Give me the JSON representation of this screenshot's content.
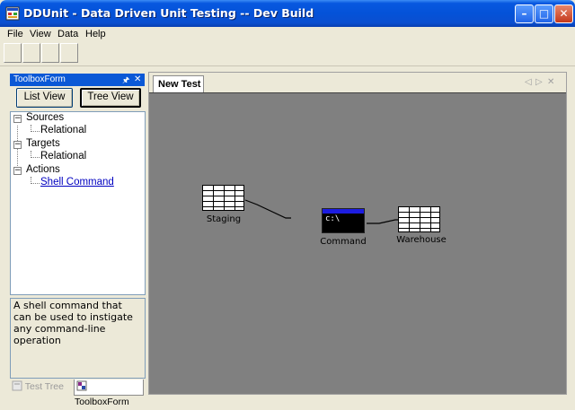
{
  "window": {
    "title": "DDUnit - Data Driven Unit Testing -- Dev Build",
    "controls": {
      "minimize": "–",
      "maximize": "□",
      "close": "✕"
    }
  },
  "menu": [
    {
      "label": "File"
    },
    {
      "label": "View"
    },
    {
      "label": "Data"
    },
    {
      "label": "Help"
    }
  ],
  "toolbox": {
    "title": "ToolboxForm",
    "pin_icon": "pin-icon",
    "close_icon": "close-icon",
    "list_view_label": "List View",
    "tree_view_label": "Tree View",
    "tree": [
      {
        "label": "Sources",
        "expanded": true,
        "children": [
          "Relational"
        ]
      },
      {
        "label": "Targets",
        "expanded": true,
        "children": [
          "Relational"
        ]
      },
      {
        "label": "Actions",
        "expanded": true,
        "children": [
          "Shell Command"
        ]
      }
    ],
    "description": "A shell command that can be used to instigate any command-line operation",
    "bottom_tabs": [
      {
        "label": "Test Tree",
        "active": false
      },
      {
        "label": "ToolboxForm",
        "active": true
      }
    ]
  },
  "document": {
    "tab_label": "New Test",
    "canvas_color": "#808080",
    "nodes": [
      {
        "label": "Staging",
        "type": "table"
      },
      {
        "label": "Command",
        "type": "console",
        "console_text": "c:\\"
      },
      {
        "label": "Warehouse",
        "type": "table"
      }
    ]
  },
  "colors": {
    "title_bar": "#0452d8",
    "panel_header": "#0a58d6",
    "link": "#0000c0",
    "canvas": "#808080"
  }
}
